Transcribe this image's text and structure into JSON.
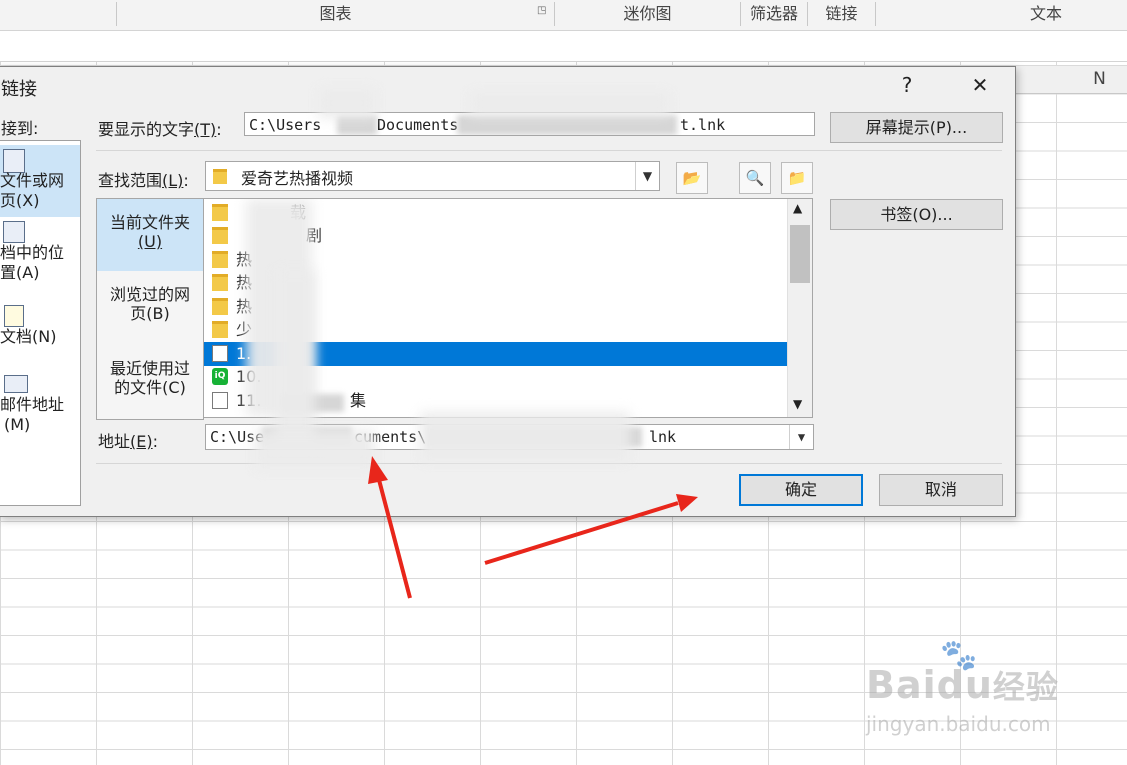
{
  "ribbon": {
    "groups": [
      "图表",
      "迷你图",
      "筛选器",
      "链接",
      "文本"
    ]
  },
  "sheet": {
    "column_n": "N"
  },
  "dialog": {
    "title": "链接",
    "help_btn": "?",
    "close_btn": "✕",
    "link_to_label": "接到:",
    "link_items": [
      {
        "line1": "文件或网",
        "line2": "页(X)"
      },
      {
        "line1": "档中的位",
        "line2": "置(A)"
      },
      {
        "line1": "文档(N)",
        "line2": ""
      },
      {
        "line1": "邮件地址",
        "line2": "(M)"
      }
    ],
    "text_label": "要显示的文字",
    "text_key": "(T)",
    "text_value_start": "C:\\Users",
    "text_value_mid": "Documents",
    "text_value_end": "t.lnk",
    "screen_tip_btn": "屏幕提示(P)...",
    "lookin_label": "查找范围",
    "lookin_key": "(L)",
    "lookin_value": "爱奇艺热播视频",
    "places": [
      {
        "line1": "当前文件夹",
        "line2": "(U)"
      },
      {
        "line1": "浏览过的网",
        "line2": "页(B)"
      },
      {
        "line1": "最近使用过",
        "line2": "的文件(C)"
      }
    ],
    "files": [
      {
        "name": "载",
        "type": "folder"
      },
      {
        "name": "剧",
        "type": "folder"
      },
      {
        "name": "热",
        "type": "folder"
      },
      {
        "name": "热",
        "type": "folder"
      },
      {
        "name": "热",
        "type": "folder"
      },
      {
        "name": "少",
        "type": "folder"
      },
      {
        "name": "1.",
        "type": "shortcut"
      },
      {
        "name": "10.",
        "type": "app"
      },
      {
        "name": "11.",
        "type": "shortcut"
      }
    ],
    "file_tail": "集",
    "bookmark_btn": "书签(O)...",
    "address_label": "地址",
    "address_key": "(E)",
    "address_start": "C:\\Use",
    "address_mid": "cuments\\",
    "address_end": "lnk",
    "ok_btn": "确定",
    "cancel_btn": "取消"
  },
  "watermark": {
    "brand": "Baidu",
    "cn": "经验",
    "url": "jingyan.baidu.com"
  },
  "colors": {
    "accent": "#0078d7",
    "arrow": "#e8261b",
    "selection": "#cce4f7"
  }
}
